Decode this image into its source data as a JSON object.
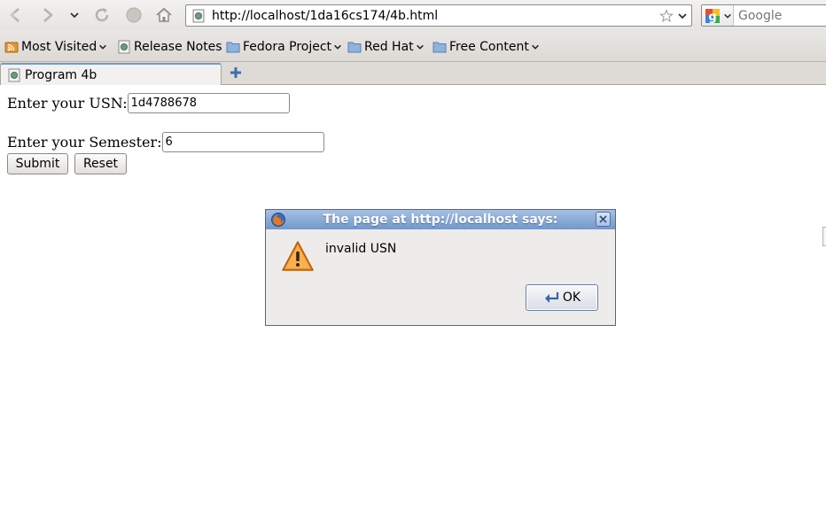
{
  "browser": {
    "url": "http://localhost/1da16cs174/4b.html",
    "search_placeholder": "Google",
    "tab_title": "Program 4b"
  },
  "bookmarks": [
    {
      "label": "Most Visited",
      "icon": "rss-folder-icon",
      "has_menu": true
    },
    {
      "label": "Release Notes",
      "icon": "page-icon",
      "has_menu": false
    },
    {
      "label": "Fedora Project",
      "icon": "folder-icon",
      "has_menu": true
    },
    {
      "label": "Red Hat",
      "icon": "folder-icon",
      "has_menu": true
    },
    {
      "label": "Free Content",
      "icon": "folder-icon",
      "has_menu": true
    }
  ],
  "form": {
    "usn_label": "Enter your USN:",
    "usn_value": "1d4788678",
    "semester_label": "Enter your Semester:",
    "semester_value": "6",
    "submit_label": "Submit",
    "reset_label": "Reset"
  },
  "dialog": {
    "title": "The page at http://localhost says:",
    "message": "invalid USN",
    "ok_label": "OK"
  },
  "colors": {
    "dialog_title_bar": "#7f9fce",
    "warning_icon": "#f08a24",
    "tab_highlight": "#6e9ad1"
  }
}
